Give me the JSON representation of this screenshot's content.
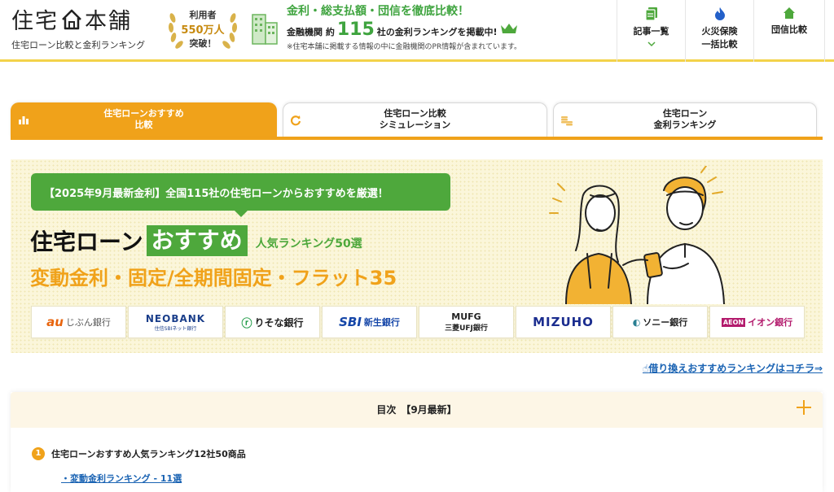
{
  "header": {
    "logo_part1": "住宅",
    "logo_part2": "本舗",
    "logo_subtitle": "住宅ローン比較と金利ランキング",
    "badge": {
      "line1": "利用者",
      "line2": "550万人",
      "line3": "突破！"
    },
    "promo": {
      "title": "金利・総支払額・団信を徹底比較！",
      "prefix": "金融機関 約",
      "count": "115",
      "suffix": "社の金利ランキングを掲載中!",
      "note": "※住宅本舗に掲載する情報の中に金融機関のPR情報が含まれています。"
    },
    "nav": [
      {
        "label": "記事一覧",
        "icon": "document-copy-icon"
      },
      {
        "label1": "火災保険",
        "label2": "一括比較",
        "icon": "flame-icon"
      },
      {
        "label": "団信比較",
        "icon": "home-icon"
      }
    ]
  },
  "tabs": [
    {
      "line1": "住宅ローンおすすめ",
      "line2": "比較",
      "icon": "bar-chart-icon",
      "active": true
    },
    {
      "line1": "住宅ローン比較",
      "line2": "シミュレーション",
      "icon": "refresh-icon",
      "active": false
    },
    {
      "line1": "住宅ローン",
      "line2": "金利ランキング",
      "icon": "coins-icon",
      "active": false
    }
  ],
  "hero": {
    "bubble": "【2025年9月最新金利】全国115社の住宅ローンからおすすめを厳選！",
    "h1_main": "住宅ローン",
    "h1_highlight": "おすすめ",
    "h1_rank": "人気ランキング50選",
    "h2": "変動金利・固定/全期間固定・フラット35",
    "banks": [
      {
        "mark": "au",
        "name": "じぶん銀行"
      },
      {
        "name": "NEOBANK",
        "sub": "住信SBIネット銀行"
      },
      {
        "mark": "ⓡ",
        "name": "りそな銀行"
      },
      {
        "mark": "SBI",
        "name": "新生銀行"
      },
      {
        "name": "MUFG",
        "sub": "三菱UFJ銀行"
      },
      {
        "name": "MIZUHO"
      },
      {
        "mark": "◐",
        "name": "ソニー銀行"
      },
      {
        "mark": "AEON",
        "name": "イオン銀行"
      }
    ]
  },
  "refinance_link": "借り換えおすすめランキングはコチラ⇒",
  "toc": {
    "title": "目次　【9月最新】",
    "items": [
      {
        "num": "1",
        "label": "住宅ローンおすすめ人気ランキング12社50商品"
      }
    ],
    "subitems": [
      "・変動金利ランキング - 11選"
    ]
  },
  "colors": {
    "accent_orange": "#f0a21a",
    "accent_green": "#4ea83c",
    "link_blue": "#1a63b3",
    "header_line": "#f3d24a"
  }
}
